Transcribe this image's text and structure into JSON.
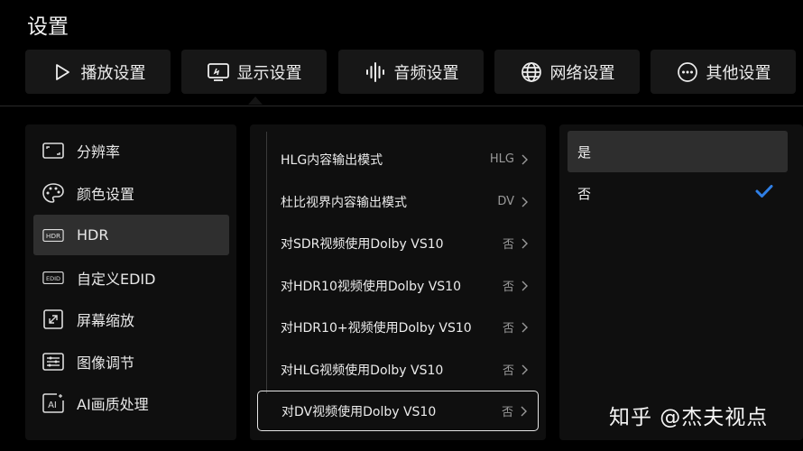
{
  "page": {
    "title": "设置"
  },
  "tabs": [
    {
      "label": "播放设置",
      "icon": "play-icon"
    },
    {
      "label": "显示设置",
      "icon": "display-icon"
    },
    {
      "label": "音频设置",
      "icon": "audio-wave-icon"
    },
    {
      "label": "网络设置",
      "icon": "globe-icon"
    },
    {
      "label": "其他设置",
      "icon": "more-icon"
    }
  ],
  "active_tab_index": 1,
  "left_menu": {
    "items": [
      {
        "label": "分辨率",
        "icon": "resolution-icon"
      },
      {
        "label": "颜色设置",
        "icon": "palette-icon"
      },
      {
        "label": "HDR",
        "icon": "hdr-icon",
        "icon_text": "HDR"
      },
      {
        "label": "自定义EDID",
        "icon": "edid-icon",
        "icon_text": "EDID"
      },
      {
        "label": "屏幕缩放",
        "icon": "screen-zoom-icon"
      },
      {
        "label": "图像调节",
        "icon": "image-adjust-icon"
      },
      {
        "label": "AI画质处理",
        "icon": "ai-icon",
        "icon_text": "AI"
      }
    ],
    "active_index": 2
  },
  "middle_menu": {
    "items": [
      {
        "label": "HLG内容输出模式",
        "value": "HLG"
      },
      {
        "label": "杜比视界内容输出模式",
        "value": "DV"
      },
      {
        "label": "对SDR视频使用Dolby VS10",
        "value": "否"
      },
      {
        "label": "对HDR10视频使用Dolby VS10",
        "value": "否"
      },
      {
        "label": "对HDR10+视频使用Dolby VS10",
        "value": "否"
      },
      {
        "label": "对HLG视频使用Dolby VS10",
        "value": "否"
      },
      {
        "label": "对DV视频使用Dolby VS10",
        "value": "否"
      }
    ],
    "focused_index": 6
  },
  "right_menu": {
    "options": [
      {
        "label": "是",
        "checked": false
      },
      {
        "label": "否",
        "checked": true
      }
    ],
    "highlighted_index": 0
  },
  "watermark": "知乎 @杰夫视点",
  "colors": {
    "accent_check": "#2f7fe6",
    "background": "#000000",
    "panel": "#0f0f0f",
    "active": "#2f2f2f"
  }
}
